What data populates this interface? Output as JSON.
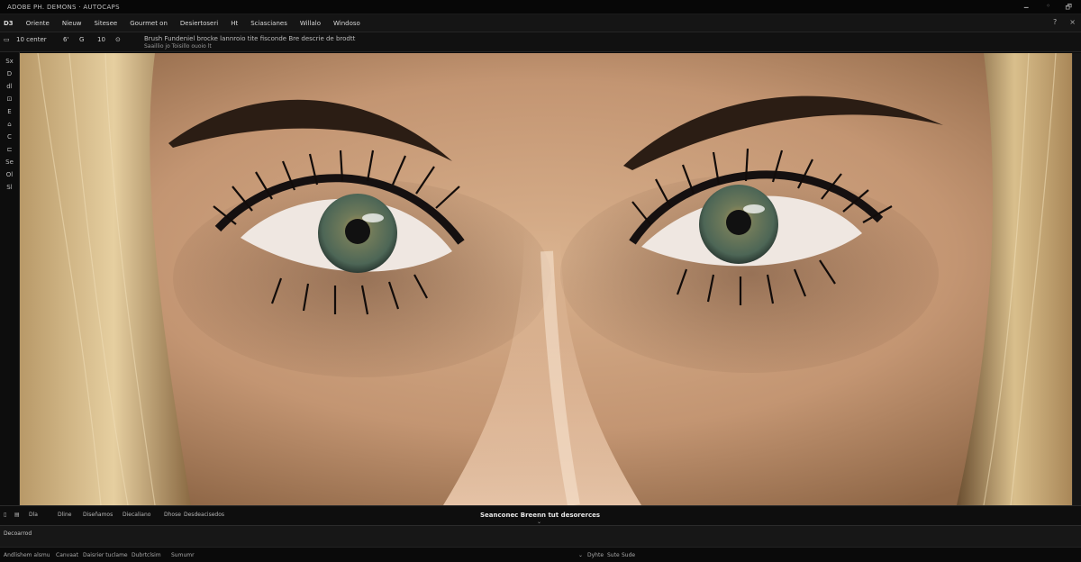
{
  "titlebar": {
    "title": "ADOBE PH. DEMONS · AUTOCAPS",
    "controls": [
      "🗕",
      "◦",
      "🗗"
    ]
  },
  "menubar": {
    "items": [
      "D3",
      "Oriente",
      "Nieuw",
      "Sitesee",
      "Gourmet on",
      "Desiertoseri",
      "Ht",
      "Sciascianes",
      "Willalo",
      "Windoso"
    ],
    "right_icons": [
      "?",
      "×"
    ]
  },
  "optionsbar": {
    "tool_label": "10 center",
    "glyph1": "6'",
    "glyph2": "G",
    "glyph3": "10",
    "glyph4": "⊙",
    "desc_line1": "Brush  Fundeniel brocke lannroio tite fisconde Bre descrie de brodtt",
    "desc_line2": "Saaillio jo  Toisillo ouoio lt"
  },
  "toolbar": {
    "tools": [
      "Sx",
      "D",
      "dl",
      "⊡",
      "E",
      "⌂",
      "C",
      "⊏",
      "Se",
      "Ol",
      "Sl"
    ]
  },
  "canvas": {
    "image_name": "portrait-closeup",
    "colors": {
      "skin": "#c9a07c",
      "skin_shadow": "#8e6646",
      "hair": "#d8bd8c",
      "iris": "#5d7260",
      "brow": "#2b1d14"
    }
  },
  "statusbar": {
    "items": [
      "Dla",
      "Dline",
      "Diseñamos",
      "Diecaliano",
      "Dhose",
      "Desdeacisedos"
    ],
    "center_text": "Seanconec Breenn tut desorerces",
    "caret": "⌄"
  },
  "panel": {
    "label": "Decoarrod"
  },
  "footer": {
    "items": [
      "Andlishem alsmu",
      "Canvaat",
      "Daisrier tuclame",
      "Dubrtclsim",
      "Sumumr"
    ],
    "right_items": [
      "⌄",
      "Dyhte",
      "Sute",
      "Sude"
    ]
  }
}
